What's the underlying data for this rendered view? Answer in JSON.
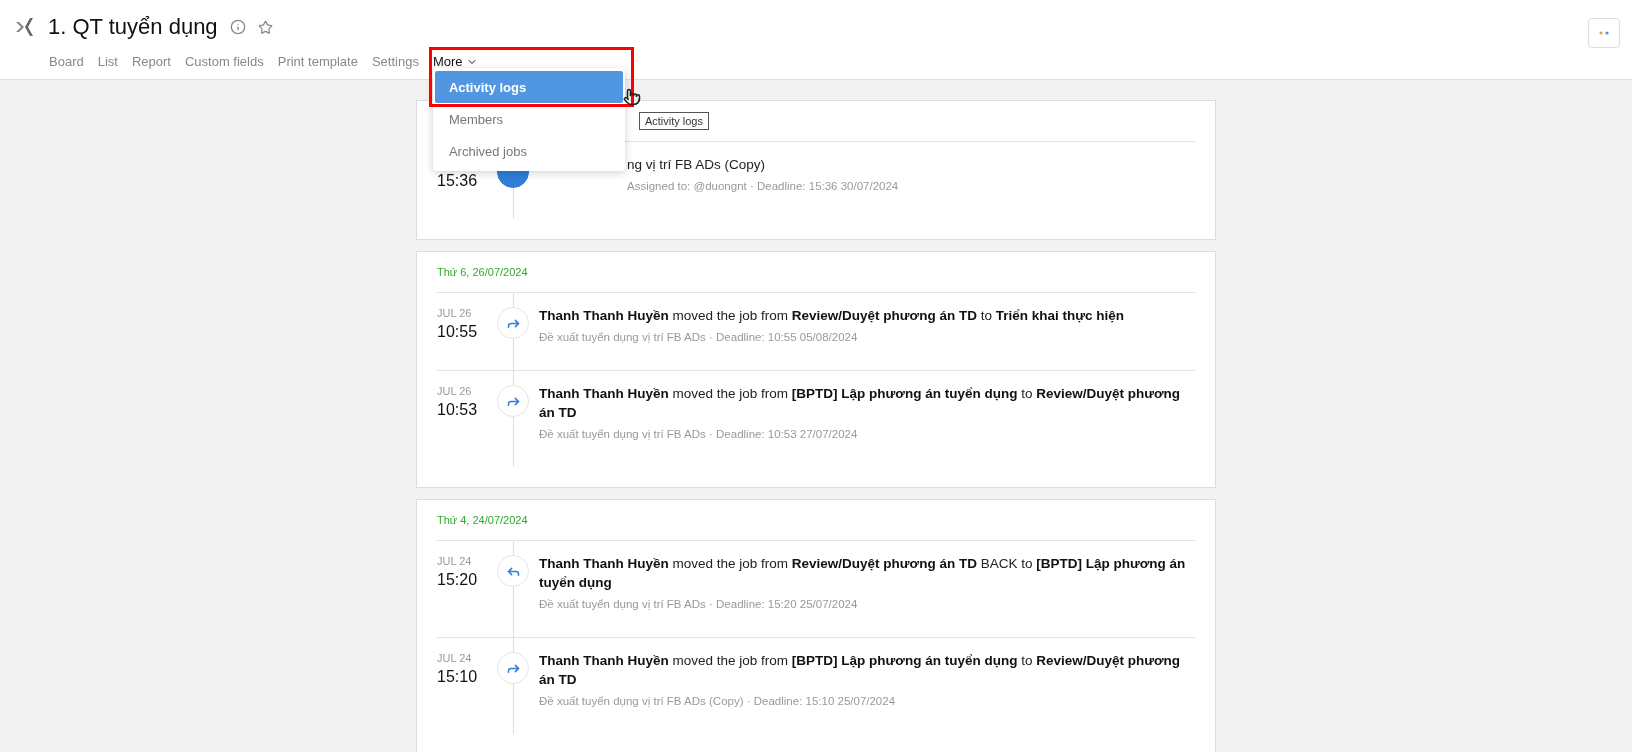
{
  "header": {
    "title": "1. QT tuyển dụng",
    "tabs": [
      {
        "label": "Board",
        "selected": false
      },
      {
        "label": "List",
        "selected": false
      },
      {
        "label": "Report",
        "selected": false
      },
      {
        "label": "Custom fields",
        "selected": false
      },
      {
        "label": "Print template",
        "selected": false
      },
      {
        "label": "Settings",
        "selected": false
      },
      {
        "label": "More",
        "selected": true
      }
    ]
  },
  "menu": {
    "items": [
      {
        "label": "Activity logs",
        "selected": true
      },
      {
        "label": "Members",
        "selected": false
      },
      {
        "label": "Archived jobs",
        "selected": false
      }
    ],
    "tooltip": "Activity logs"
  },
  "groups": [
    {
      "entries": [
        {
          "kind": "assigned",
          "covered": true,
          "time": "15:36",
          "text": "ng vị trí FB ADs (Copy)",
          "detail": "Assigned to: @duongnt · Deadline: 15:36 30/07/2024"
        }
      ]
    },
    {
      "date": "Thứ 6, 26/07/2024",
      "entries": [
        {
          "kind": "forward",
          "covered": false,
          "month": "JUL 26",
          "time": "10:55",
          "text": "**Thanh Thanh Huyền** moved the job from **Review/Duyệt phương án TD** to **Triển khai thực hiện**",
          "detail": "Đề xuất tuyển dụng vị trí FB ADs · Deadline: 10:55 05/08/2024"
        },
        {
          "kind": "forward",
          "covered": false,
          "month": "JUL 26",
          "time": "10:53",
          "text": "**Thanh Thanh Huyền** moved the job from **[BPTD] Lập phương án tuyển dụng** to **Review/Duyệt phương án TD**",
          "detail": "Đề xuất tuyển dụng vị trí FB ADs · Deadline: 10:53 27/07/2024"
        }
      ]
    },
    {
      "date": "Thứ 4, 24/07/2024",
      "entries": [
        {
          "kind": "back",
          "covered": false,
          "month": "JUL 24",
          "time": "15:20",
          "text": "**Thanh Thanh Huyền** moved the job from **Review/Duyệt phương án TD** BACK to **[BPTD] Lập phương án tuyển dụng**",
          "detail": "Đề xuất tuyển dụng vị trí FB ADs · Deadline: 15:20 25/07/2024"
        },
        {
          "kind": "forward",
          "covered": false,
          "month": "JUL 24",
          "time": "15:10",
          "text": "**Thanh Thanh Huyền** moved the job from **[BPTD] Lập phương án tuyển dụng** to **Review/Duyệt phương án TD**",
          "detail": "Đề xuất tuyển dụng vị trí FB ADs (Copy) · Deadline: 15:10 25/07/2024"
        }
      ]
    }
  ]
}
